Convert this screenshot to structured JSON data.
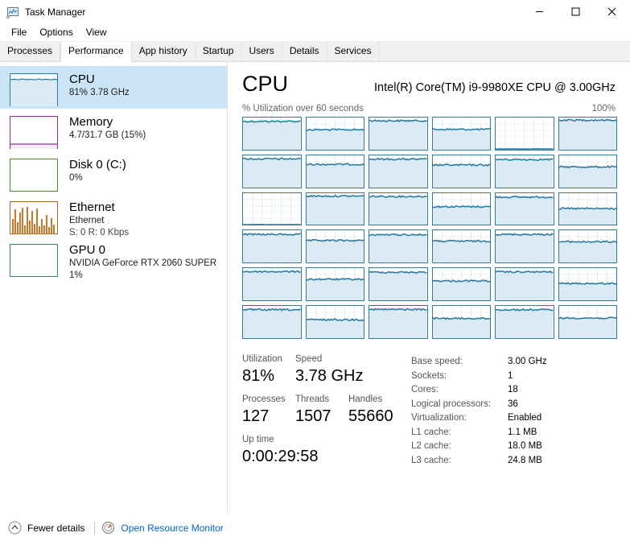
{
  "window": {
    "title": "Task Manager",
    "icon": "task-manager-icon",
    "controls": {
      "minimize": "minimize-icon",
      "maximize": "maximize-icon",
      "close": "close-icon"
    }
  },
  "menu": {
    "items": [
      "File",
      "Options",
      "View"
    ]
  },
  "tabs": {
    "items": [
      "Processes",
      "Performance",
      "App history",
      "Startup",
      "Users",
      "Details",
      "Services"
    ],
    "active": "Performance"
  },
  "sidebar": {
    "items": [
      {
        "title": "CPU",
        "sub1": "81% 3.78 GHz",
        "sub2": "",
        "color": "#2e7ca1",
        "selected": true,
        "thumb": "cpu-thumb"
      },
      {
        "title": "Memory",
        "sub1": "4.7/31.7 GB (15%)",
        "sub2": "",
        "color": "#8b2f8b",
        "selected": false,
        "thumb": "memory-thumb"
      },
      {
        "title": "Disk 0 (C:)",
        "sub1": "0%",
        "sub2": "",
        "color": "#4e8a23",
        "selected": false,
        "thumb": "disk-thumb"
      },
      {
        "title": "Ethernet",
        "sub1": "Ethernet",
        "sub2": "S: 0 R: 0 Kbps",
        "color": "#b0641e",
        "selected": false,
        "thumb": "ethernet-thumb"
      },
      {
        "title": "GPU 0",
        "sub1": "NVIDIA GeForce RTX 2060 SUPER",
        "sub2": "1%",
        "color": "#2e7ca1",
        "selected": false,
        "thumb": "gpu-thumb"
      }
    ]
  },
  "main": {
    "title": "CPU",
    "model": "Intel(R) Core(TM) i9-9980XE CPU @ 3.00GHz",
    "graph_caption": "% Utilization over 60 seconds",
    "graph_max": "100%",
    "accent": "#2e7ca1"
  },
  "stats": {
    "utilization_label": "Utilization",
    "utilization_value": "81%",
    "speed_label": "Speed",
    "speed_value": "3.78 GHz",
    "processes_label": "Processes",
    "processes_value": "127",
    "threads_label": "Threads",
    "threads_value": "1507",
    "handles_label": "Handles",
    "handles_value": "55660",
    "uptime_label": "Up time",
    "uptime_value": "0:00:29:58"
  },
  "specs": [
    {
      "name": "Base speed:",
      "value": "3.00 GHz"
    },
    {
      "name": "Sockets:",
      "value": "1"
    },
    {
      "name": "Cores:",
      "value": "18"
    },
    {
      "name": "Logical processors:",
      "value": "36"
    },
    {
      "name": "Virtualization:",
      "value": "Enabled"
    },
    {
      "name": "L1 cache:",
      "value": "1.1 MB"
    },
    {
      "name": "L2 cache:",
      "value": "18.0 MB"
    },
    {
      "name": "L3 cache:",
      "value": "24.8 MB"
    }
  ],
  "statusbar": {
    "fewer_details": "Fewer details",
    "resource_monitor": "Open Resource Monitor",
    "chevron_icon": "chevron-up-icon",
    "monitor_icon": "resource-monitor-icon"
  },
  "chart_data": {
    "type": "line",
    "title": "% Utilization over 60 seconds",
    "xlabel": "60 seconds",
    "ylabel": "% Utilization",
    "ylim": [
      0,
      100
    ],
    "xlim": [
      0,
      60
    ],
    "grid": true,
    "legend": "none",
    "note": "36 per-logical-processor utilization sparklines, 6 rows x 6 columns",
    "series": [
      {
        "name": "CPU 0",
        "level": 88
      },
      {
        "name": "CPU 1",
        "level": 62
      },
      {
        "name": "CPU 2",
        "level": 90
      },
      {
        "name": "CPU 3",
        "level": 63
      },
      {
        "name": "CPU 4",
        "level": 2
      },
      {
        "name": "CPU 5",
        "level": 92
      },
      {
        "name": "CPU 6",
        "level": 89
      },
      {
        "name": "CPU 7",
        "level": 72
      },
      {
        "name": "CPU 8",
        "level": 88
      },
      {
        "name": "CPU 9",
        "level": 70
      },
      {
        "name": "CPU 10",
        "level": 87
      },
      {
        "name": "CPU 11",
        "level": 64
      },
      {
        "name": "CPU 12",
        "level": 2
      },
      {
        "name": "CPU 13",
        "level": 91
      },
      {
        "name": "CPU 14",
        "level": 90
      },
      {
        "name": "CPU 15",
        "level": 58
      },
      {
        "name": "CPU 16",
        "level": 88
      },
      {
        "name": "CPU 17",
        "level": 52
      },
      {
        "name": "CPU 18",
        "level": 87
      },
      {
        "name": "CPU 19",
        "level": 68
      },
      {
        "name": "CPU 20",
        "level": 86
      },
      {
        "name": "CPU 21",
        "level": 66
      },
      {
        "name": "CPU 22",
        "level": 87
      },
      {
        "name": "CPU 23",
        "level": 64
      },
      {
        "name": "CPU 24",
        "level": 89
      },
      {
        "name": "CPU 25",
        "level": 65
      },
      {
        "name": "CPU 26",
        "level": 87
      },
      {
        "name": "CPU 27",
        "level": 60
      },
      {
        "name": "CPU 28",
        "level": 88
      },
      {
        "name": "CPU 29",
        "level": 52
      },
      {
        "name": "CPU 30",
        "level": 88
      },
      {
        "name": "CPU 31",
        "level": 57
      },
      {
        "name": "CPU 32",
        "level": 89
      },
      {
        "name": "CPU 33",
        "level": 61
      },
      {
        "name": "CPU 34",
        "level": 88
      },
      {
        "name": "CPU 35",
        "level": 62
      }
    ]
  }
}
